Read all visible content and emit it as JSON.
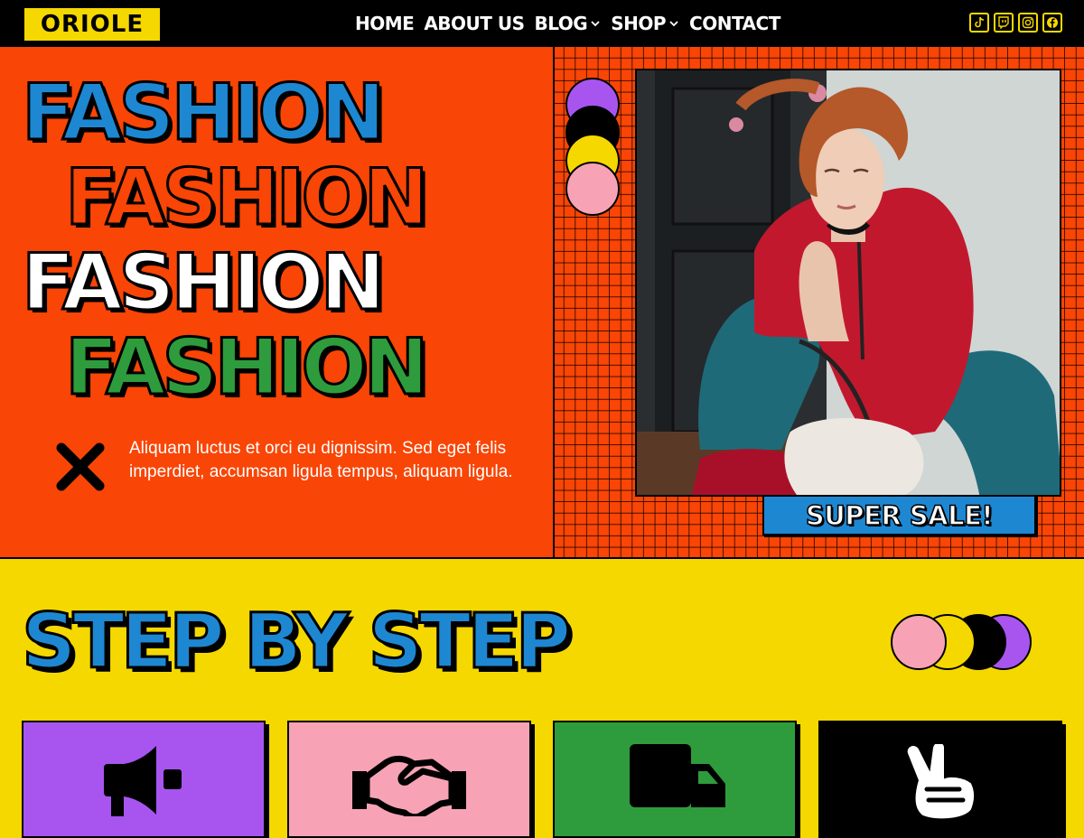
{
  "brand": {
    "logo_text": "ORIOLE"
  },
  "nav": {
    "items": [
      {
        "label": "HOME",
        "has_dropdown": false
      },
      {
        "label": "ABOUT US",
        "has_dropdown": false
      },
      {
        "label": "BLOG",
        "has_dropdown": true
      },
      {
        "label": "SHOP",
        "has_dropdown": true
      },
      {
        "label": "CONTACT",
        "has_dropdown": false
      }
    ],
    "social_icons": [
      "tiktok-icon",
      "twitch-icon",
      "instagram-icon",
      "facebook-icon"
    ]
  },
  "hero": {
    "headline_lines": [
      "FASHION",
      "FASHION",
      "FASHION",
      "FASHION"
    ],
    "headline_colors": [
      "#1e87d2",
      "#f94505",
      "#ffffff",
      "#2e9c3c"
    ],
    "body_text": "Aliquam luctus et orci eu dignissim. Sed eget felis imperdiet, accumsan ligula tempus, aliquam ligula.",
    "decor_circle_colors": [
      "#a855f0",
      "#000000",
      "#f5d800",
      "#f7a3b5"
    ],
    "sale_label": "SUPER SALE!"
  },
  "steps": {
    "title": "STEP BY STEP",
    "decor_circle_colors": [
      "#f7a3b5",
      "#f5d800",
      "#000000",
      "#a855f0"
    ],
    "cards": [
      {
        "color": "#a855f0",
        "icon": "megaphone-icon"
      },
      {
        "color": "#f7a3b5",
        "icon": "handshake-icon"
      },
      {
        "color": "#2e9c3c",
        "icon": "truck-icon"
      },
      {
        "color": "#000000",
        "icon": "peace-hand-icon"
      }
    ]
  },
  "colors": {
    "hero_bg": "#f94505",
    "page_bg": "#f5d800",
    "nav_bg": "#000000",
    "accent_blue": "#1e87d2"
  }
}
